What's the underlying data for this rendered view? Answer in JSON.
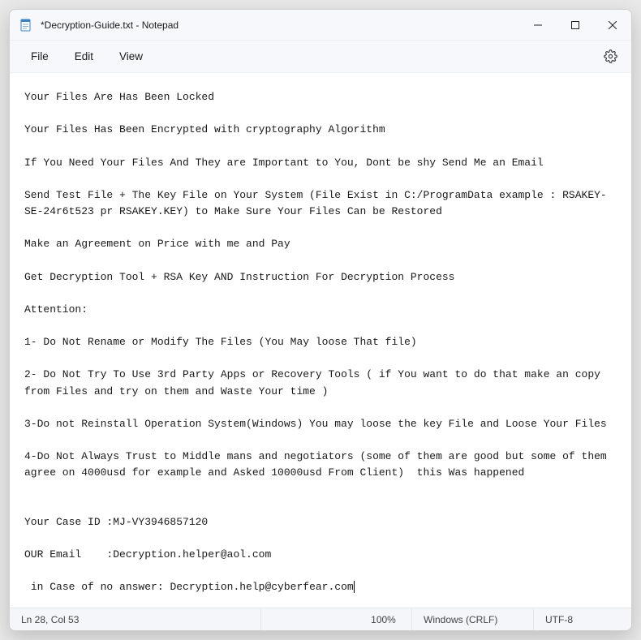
{
  "titlebar": {
    "title": "*Decryption-Guide.txt - Notepad"
  },
  "menu": {
    "file": "File",
    "edit": "Edit",
    "view": "View"
  },
  "editor": {
    "text": "Your Files Are Has Been Locked\n\nYour Files Has Been Encrypted with cryptography Algorithm\n\nIf You Need Your Files And They are Important to You, Dont be shy Send Me an Email\n\nSend Test File + The Key File on Your System (File Exist in C:/ProgramData example : RSAKEY-SE-24r6t523 pr RSAKEY.KEY) to Make Sure Your Files Can be Restored\n\nMake an Agreement on Price with me and Pay\n\nGet Decryption Tool + RSA Key AND Instruction For Decryption Process\n\nAttention:\n\n1- Do Not Rename or Modify The Files (You May loose That file)\n\n2- Do Not Try To Use 3rd Party Apps or Recovery Tools ( if You want to do that make an copy from Files and try on them and Waste Your time )\n\n3-Do not Reinstall Operation System(Windows) You may loose the key File and Loose Your Files\n\n4-Do Not Always Trust to Middle mans and negotiators (some of them are good but some of them agree on 4000usd for example and Asked 10000usd From Client)  this Was happened\n\n\nYour Case ID :MJ-VY3946857120\n\nOUR Email    :Decryption.helper@aol.com\n\n in Case of no answer: Decryption.help@cyberfear.com"
  },
  "statusbar": {
    "position": "Ln 28, Col 53",
    "zoom": "100%",
    "lineending": "Windows (CRLF)",
    "encoding": "UTF-8"
  }
}
